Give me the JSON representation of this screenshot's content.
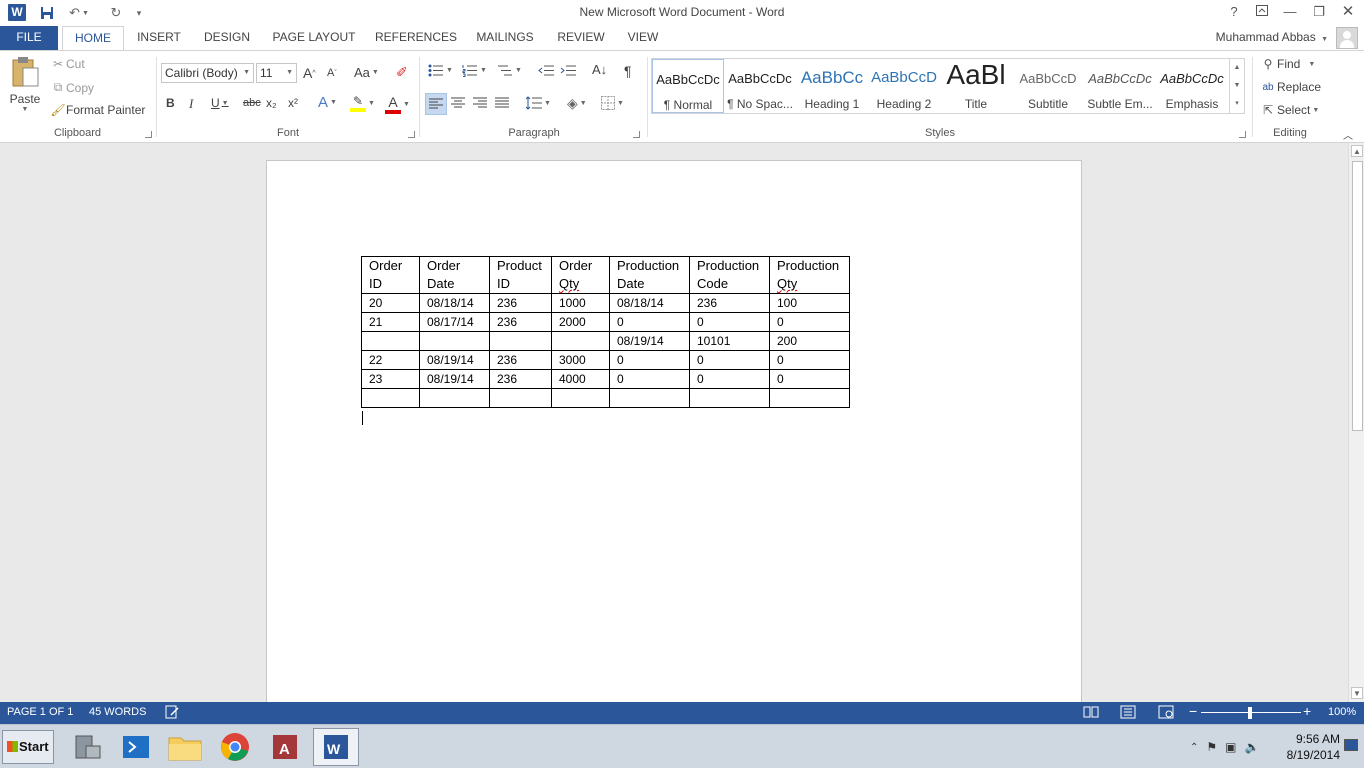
{
  "window": {
    "title": "New Microsoft Word Document - Word",
    "help": "?"
  },
  "tabs": [
    "FILE",
    "HOME",
    "INSERT",
    "DESIGN",
    "PAGE LAYOUT",
    "REFERENCES",
    "MAILINGS",
    "REVIEW",
    "VIEW"
  ],
  "user": {
    "name": "Muhammad Abbas"
  },
  "clipboard": {
    "paste": "Paste",
    "cut": "Cut",
    "copy": "Copy",
    "format_painter": "Format Painter",
    "label": "Clipboard"
  },
  "font": {
    "family": "Calibri (Body)",
    "size": "11",
    "label": "Font",
    "bold": "B",
    "italic": "I",
    "underline": "U",
    "strike": "abc",
    "subscript": "x₂",
    "superscript": "x²",
    "grow": "A",
    "shrink": "A",
    "change_case": "Aa",
    "font_color": "A"
  },
  "paragraph": {
    "label": "Paragraph"
  },
  "styles": {
    "label": "Styles",
    "items": [
      {
        "preview": "AaBbCcDc",
        "name": "¶ Normal"
      },
      {
        "preview": "AaBbCcDc",
        "name": "¶ No Spac..."
      },
      {
        "preview": "AaBbCc",
        "name": "Heading 1"
      },
      {
        "preview": "AaBbCcD",
        "name": "Heading 2"
      },
      {
        "preview": "AaBl",
        "name": "Title"
      },
      {
        "preview": "AaBbCcD",
        "name": "Subtitle"
      },
      {
        "preview": "AaBbCcDc",
        "name": "Subtle Em..."
      },
      {
        "preview": "AaBbCcDc",
        "name": "Emphasis"
      }
    ]
  },
  "editing": {
    "label": "Editing",
    "find": "Find",
    "replace": "Replace",
    "select": "Select"
  },
  "document": {
    "table": {
      "headers": [
        [
          "Order",
          "ID"
        ],
        [
          "Order",
          "Date"
        ],
        [
          "Product",
          "ID"
        ],
        [
          "Order",
          "Qty"
        ],
        [
          "Production",
          "Date"
        ],
        [
          "Production",
          "Code"
        ],
        [
          "Production",
          "Qty"
        ]
      ],
      "rows": [
        [
          "20",
          "08/18/14",
          "236",
          "1000",
          "08/18/14",
          "236",
          "100"
        ],
        [
          "21",
          "08/17/14",
          "236",
          "2000",
          "0",
          "0",
          "0"
        ],
        [
          "",
          "",
          "",
          "",
          "08/19/14",
          "10101",
          "200"
        ],
        [
          "22",
          "08/19/14",
          "236",
          "3000",
          "0",
          "0",
          "0"
        ],
        [
          "23",
          "08/19/14",
          "236",
          "4000",
          "0",
          "0",
          "0"
        ],
        [
          "",
          "",
          "",
          "",
          "",
          "",
          ""
        ]
      ]
    }
  },
  "status": {
    "page": "PAGE 1 OF 1",
    "words": "45 WORDS",
    "zoom": "100%",
    "zoom_minus": "−",
    "zoom_plus": "+"
  },
  "taskbar": {
    "start": "Start",
    "time": "9:56 AM",
    "date": "8/19/2014"
  },
  "colors": {
    "accent": "#2b579a",
    "statusbar": "#2b579a"
  }
}
